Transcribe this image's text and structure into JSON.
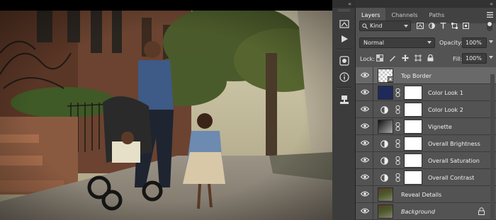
{
  "panel": {
    "collapse_glyph": "«",
    "tabs": [
      {
        "label": "Layers",
        "active": true
      },
      {
        "label": "Channels",
        "active": false
      },
      {
        "label": "Paths",
        "active": false
      }
    ],
    "filter": {
      "kind_label": "Kind"
    },
    "blend_mode": "Normal",
    "opacity": {
      "label": "Opacity:",
      "value": "100%"
    },
    "lock": {
      "label": "Lock:"
    },
    "fill": {
      "label": "Fill:",
      "value": "100%"
    }
  },
  "toolstrip": {
    "icons": [
      "brush-preset-icon",
      "play-icon",
      "adjustments-icon",
      "info-icon",
      "clone-source-icon"
    ]
  },
  "layers": [
    {
      "name": "Top Border",
      "type": "pixel",
      "selected": true
    },
    {
      "name": "Color Look 1",
      "type": "solid",
      "thumb_color": "#1f2a5a"
    },
    {
      "name": "Color Look 2",
      "type": "adjustment"
    },
    {
      "name": "Vignette",
      "type": "gradient"
    },
    {
      "name": "Overall Brightness",
      "type": "adjustment"
    },
    {
      "name": "Overall Saturation",
      "type": "adjustment"
    },
    {
      "name": "Overall Contrast",
      "type": "adjustment"
    },
    {
      "name": "Reveal Details",
      "type": "photo"
    },
    {
      "name": "Background",
      "type": "photo",
      "locked": true
    }
  ],
  "colors": {
    "panel_bg": "#535353",
    "selected_row": "#696969",
    "tab_bar": "#424242"
  }
}
